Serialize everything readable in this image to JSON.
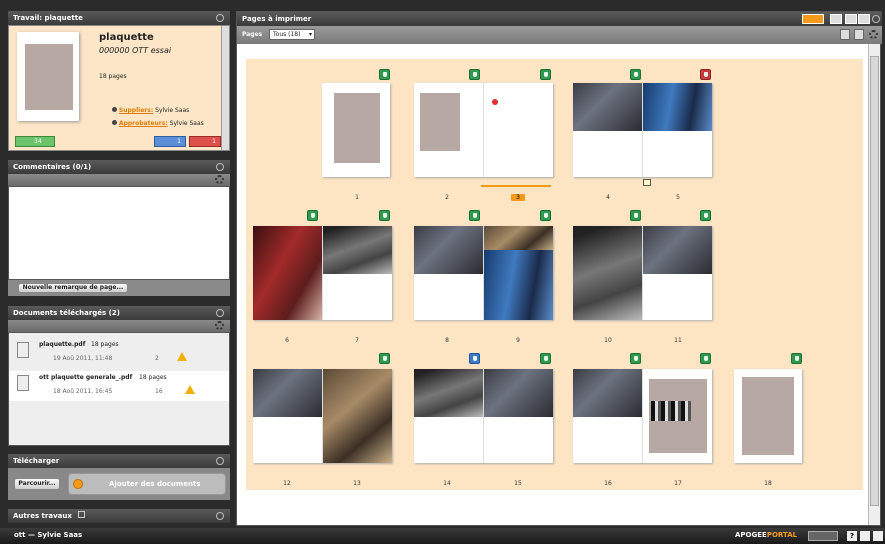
{
  "work_panel": {
    "title": "Travail: plaquette",
    "name": "plaquette",
    "subtitle": "000000 OTT essai",
    "pages": "18 pages",
    "supplier_label": "Suppliers:",
    "supplier_name": "Sylvie Saas",
    "approver_label": "Approbateurs:",
    "approver_name": "Sylvie Saas",
    "count_green": "34",
    "count_blue": "1",
    "count_red": "1"
  },
  "comments_panel": {
    "title": "Commentaires (0/1)",
    "new_button": "Nouvelle remarque de page..."
  },
  "docs_panel": {
    "title": "Documents téléchargés (2)",
    "docs": [
      {
        "name": "plaquette.pdf",
        "pages": "18 pages",
        "date": "19 Aoû 2011, 11:48",
        "count": "2"
      },
      {
        "name": "ott plaquette generale_.pdf",
        "pages": "18 pages",
        "date": "18 Aoû 2011, 16:45",
        "count": "16"
      }
    ]
  },
  "upload_panel": {
    "title": "Télécharger",
    "browse_button": "Parcourir...",
    "add_label": "Ajouter des documents"
  },
  "other_panel": {
    "title": "Autres travaux"
  },
  "main": {
    "title": "Pages à imprimer",
    "pages_label": "Pages",
    "select_value": "Tous (18)",
    "spread_numbers": [
      "1",
      "2",
      "3",
      "4",
      "5",
      "6",
      "7",
      "8",
      "9",
      "10",
      "11",
      "12",
      "13",
      "14",
      "15",
      "16",
      "17",
      "18"
    ]
  },
  "footer": {
    "user": "ott — Sylvie Saas",
    "brand_a": "APOGEE",
    "brand_b": "PORTAL",
    "help": "?"
  },
  "colors": {
    "canvas_bg": "#fde5c4",
    "work_bg": "#fde6c7",
    "accent_orange": "#f39a1a",
    "status_green": "#2f9a4e",
    "status_red": "#c83a3a",
    "status_blue": "#3b7ac9"
  }
}
